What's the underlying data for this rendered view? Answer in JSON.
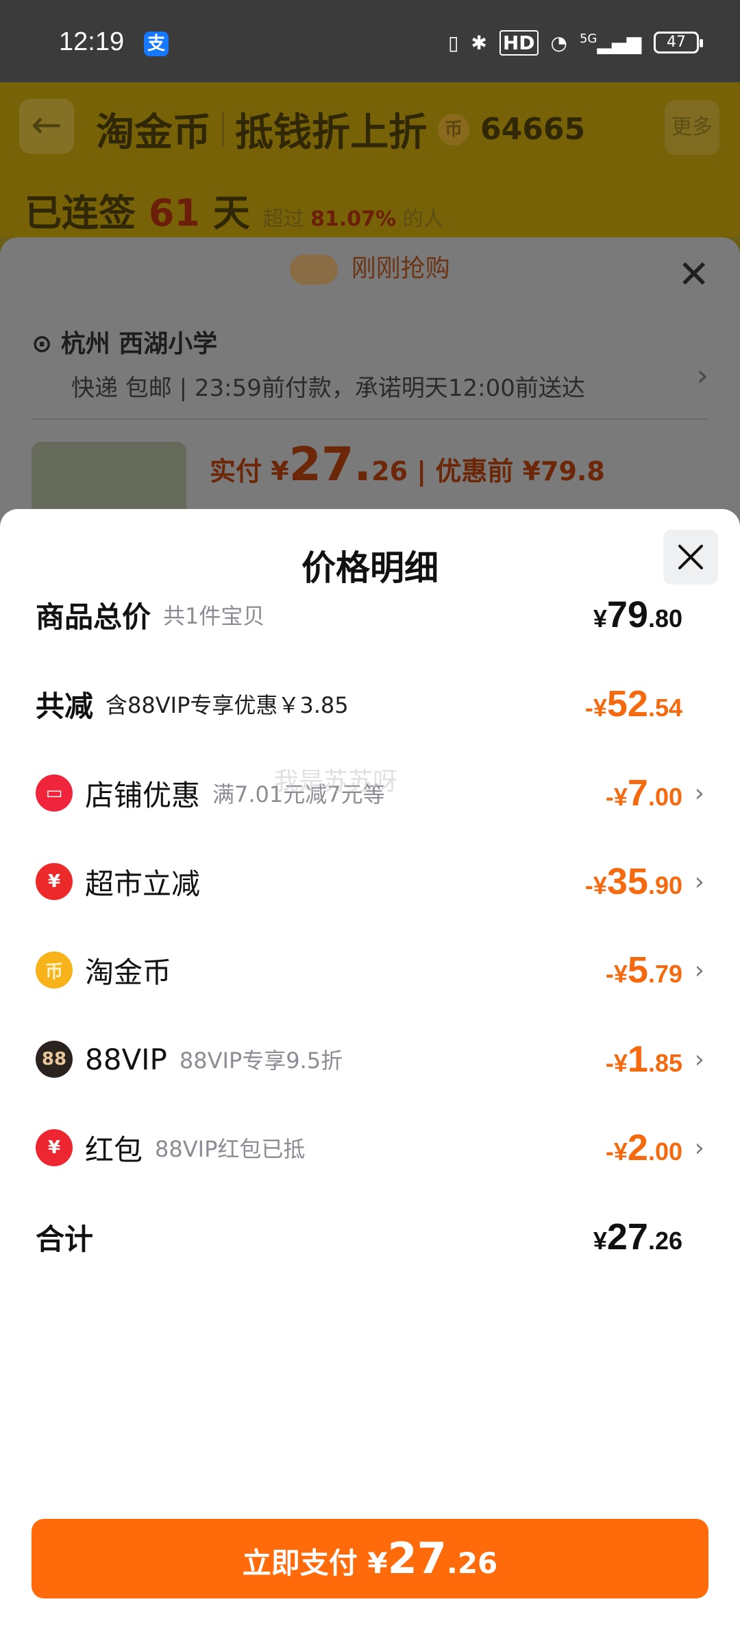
{
  "status_bar": {
    "time": "12:19",
    "alipay_glyph": "支",
    "signal_label": "5G",
    "hd_label": "HD",
    "battery": "47"
  },
  "background": {
    "back_glyph": "←",
    "title": "淘金币",
    "subtitle": "抵钱折上折",
    "coin_glyph": "币",
    "coins": "64665",
    "more": "更多",
    "sign_prefix": "已连签",
    "sign_days": "61",
    "sign_suffix": "天",
    "sign_note_prefix": "超过",
    "sign_note_percent": "81.07%",
    "sign_note_suffix": "的人",
    "grab_text": "刚刚抢购",
    "address": "杭州 西湖小学",
    "delivery": "快递 包邮 | 23:59前付款，承诺明天12:00前送达",
    "price_prefix": "实付 ¥",
    "price_int": "27.",
    "price_dec": "26",
    "price_before": "| 优惠前 ¥79.8"
  },
  "sheet": {
    "title": "价格明细",
    "rows": [
      {
        "label": "商品总价",
        "sub": "共1件宝贝",
        "cur": "¥",
        "int": "79",
        "dec": ".80"
      },
      {
        "label": "共减",
        "sub": "含88VIP专享优惠￥3.85",
        "cur": "-¥",
        "int": "52",
        "dec": ".54"
      },
      {
        "label": "店铺优惠",
        "sub": "满7.01元减7元等",
        "cur": "-¥",
        "int": "7",
        "dec": ".00",
        "icon": "store-icon",
        "icon_glyph": "▭"
      },
      {
        "label": "超市立减",
        "sub": "",
        "cur": "-¥",
        "int": "35",
        "dec": ".90",
        "icon": "supermarket-discount-icon",
        "icon_glyph": "¥"
      },
      {
        "label": "淘金币",
        "sub": "",
        "cur": "-¥",
        "int": "5",
        "dec": ".79",
        "icon": "taobao-coin-icon",
        "icon_glyph": "币"
      },
      {
        "label": "88VIP",
        "sub": "88VIP专享9.5折",
        "cur": "-¥",
        "int": "1",
        "dec": ".85",
        "icon": "88vip-icon",
        "icon_glyph": "88"
      },
      {
        "label": "红包",
        "sub": "88VIP红包已抵",
        "cur": "-¥",
        "int": "2",
        "dec": ".00",
        "icon": "red-packet-icon",
        "icon_glyph": "¥"
      },
      {
        "label": "合计",
        "sub": "",
        "cur": "¥",
        "int": "27",
        "dec": ".26"
      }
    ],
    "watermark": "我是苏苏呀",
    "chevron": "›",
    "pay_button": {
      "label": "立即支付 ¥",
      "int": "27",
      "dec": ".26"
    }
  },
  "colors": {
    "accent": "#ff6a0a",
    "discount": "#f5690f"
  }
}
